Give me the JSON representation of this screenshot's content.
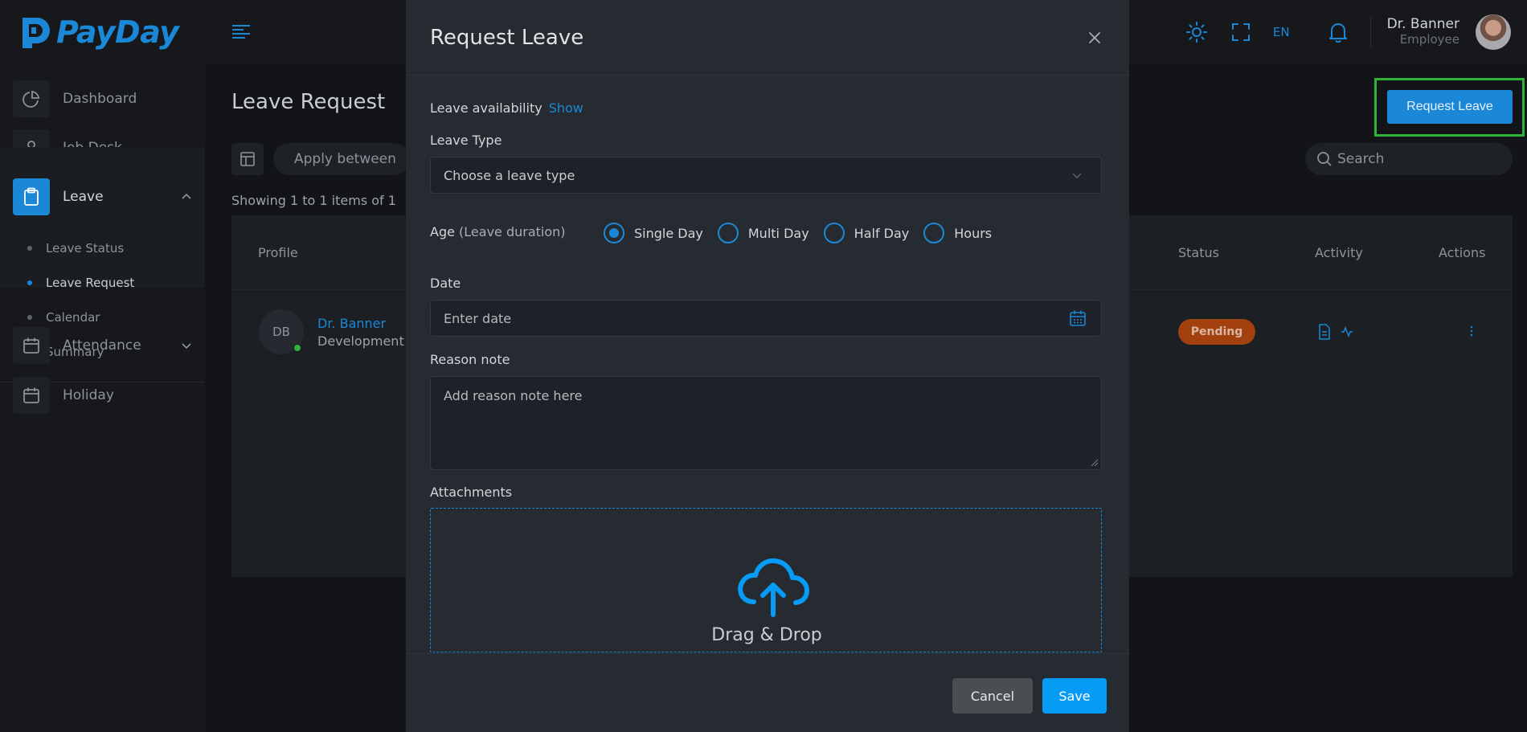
{
  "colors": {
    "accent": "#1a88d6",
    "status_pending": "#a3410e",
    "online": "#2fb23a",
    "highlight": "#2fb23a"
  },
  "brand": {
    "name": "PayDay",
    "logo_icon": "payday-logo-icon"
  },
  "topbar": {
    "menu_icon": "menu-lines-icon",
    "theme_icon": "sun-icon",
    "fullscreen_icon": "fullscreen-icon",
    "language": "EN",
    "notification_icon": "bell-icon",
    "user": {
      "name": "Dr. Banner",
      "role": "Employee"
    }
  },
  "sidebar": {
    "items": [
      {
        "label": "Dashboard",
        "icon": "pie-chart-icon"
      },
      {
        "label": "Job Desk",
        "icon": "user-icon"
      },
      {
        "label": "Leave",
        "icon": "clipboard-icon",
        "active": true,
        "expanded": true,
        "subitems": [
          {
            "label": "Leave Status"
          },
          {
            "label": "Leave Request",
            "active": true
          },
          {
            "label": "Calendar"
          },
          {
            "label": "Summary"
          }
        ]
      },
      {
        "label": "Attendance",
        "icon": "calendar-icon"
      },
      {
        "label": "Holiday",
        "icon": "calendar-icon"
      }
    ]
  },
  "page": {
    "title": "Leave Request",
    "request_button": "Request Leave",
    "filter_pill": "Apply between",
    "search_placeholder": "Search",
    "showing": "Showing 1 to 1 items of 1",
    "table": {
      "headers": {
        "profile": "Profile",
        "status": "Status",
        "activity": "Activity",
        "actions": "Actions"
      },
      "rows": [
        {
          "initials": "DB",
          "name": "Dr. Banner",
          "department": "Development",
          "status": "Pending"
        }
      ]
    }
  },
  "modal": {
    "title": "Request Leave",
    "availability_label": "Leave availability",
    "availability_link": "Show",
    "leave_type_label": "Leave Type",
    "leave_type_placeholder": "Choose a leave type",
    "age_label": "Age",
    "age_hint": "(Leave duration)",
    "duration_options": [
      {
        "label": "Single Day",
        "selected": true
      },
      {
        "label": "Multi Day",
        "selected": false
      },
      {
        "label": "Half Day",
        "selected": false
      },
      {
        "label": "Hours",
        "selected": false
      }
    ],
    "date_label": "Date",
    "date_placeholder": "Enter date",
    "reason_label": "Reason note",
    "reason_placeholder": "Add reason note here",
    "attachments_label": "Attachments",
    "dropzone_text": "Drag & Drop",
    "cancel": "Cancel",
    "save": "Save"
  }
}
